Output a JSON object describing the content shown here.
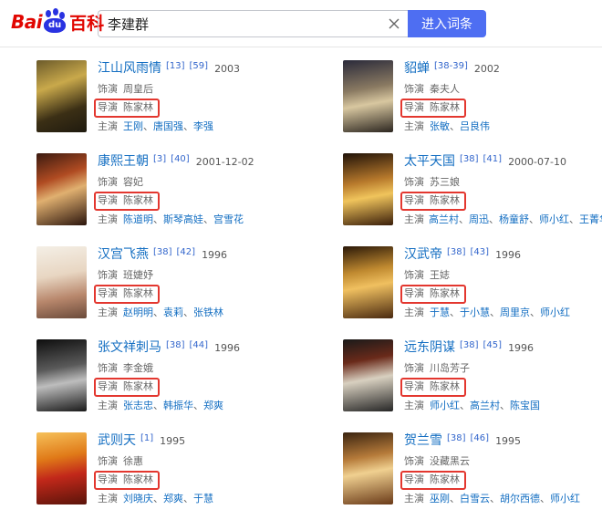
{
  "brand": {
    "bai": "Bai",
    "du": "du",
    "baike": "百科",
    "red": "#e10601",
    "blue": "#2932e1"
  },
  "search": {
    "value": "李建群",
    "button": "进入词条",
    "clear_icon": "close-icon"
  },
  "accent": {
    "link": "#136ec2",
    "highlight": "#e3372f",
    "button": "#4e6ef2"
  },
  "labels": {
    "role": "饰演",
    "director": "导演",
    "cast": "主演"
  },
  "works": [
    {
      "title": "江山风雨情",
      "refs": [
        "[13]",
        "[59]"
      ],
      "year": "2003",
      "role": "周皇后",
      "director": "陈家林",
      "cast": [
        "王刚",
        "唐国强",
        "李强"
      ]
    },
    {
      "title": "貂蝉",
      "refs": [
        "[38-39]"
      ],
      "year": "2002",
      "role": "秦夫人",
      "director": "陈家林",
      "cast": [
        "张敏",
        "吕良伟"
      ]
    },
    {
      "title": "康熙王朝",
      "refs": [
        "[3]",
        "[40]"
      ],
      "year": "2001-12-02",
      "role": "容妃",
      "director": "陈家林",
      "cast": [
        "陈道明",
        "斯琴高娃",
        "宫雪花"
      ]
    },
    {
      "title": "太平天国",
      "refs": [
        "[38]",
        "[41]"
      ],
      "year": "2000-07-10",
      "role": "苏三娘",
      "director": "陈家林",
      "cast": [
        "高兰村",
        "周迅",
        "杨童舒",
        "师小红",
        "王菁华"
      ]
    },
    {
      "title": "汉宫飞燕",
      "refs": [
        "[38]",
        "[42]"
      ],
      "year": "1996",
      "role": "班婕妤",
      "director": "陈家林",
      "cast": [
        "赵明明",
        "袁莉",
        "张铁林"
      ]
    },
    {
      "title": "汉武帝",
      "refs": [
        "[38]",
        "[43]"
      ],
      "year": "1996",
      "role": "王娡",
      "director": "陈家林",
      "cast": [
        "于慧",
        "于小慧",
        "周里京",
        "师小红"
      ]
    },
    {
      "title": "张文祥刺马",
      "refs": [
        "[38]",
        "[44]"
      ],
      "year": "1996",
      "role": "李金娥",
      "director": "陈家林",
      "cast": [
        "张志忠",
        "韩振华",
        "郑爽"
      ]
    },
    {
      "title": "远东阴谋",
      "refs": [
        "[38]",
        "[45]"
      ],
      "year": "1996",
      "role": "川岛芳子",
      "director": "陈家林",
      "cast": [
        "师小红",
        "高兰村",
        "陈宝国"
      ]
    },
    {
      "title": "武则天",
      "refs": [
        "[1]"
      ],
      "year": "1995",
      "role": "徐惠",
      "director": "陈家林",
      "cast": [
        "刘晓庆",
        "郑爽",
        "于慧"
      ]
    },
    {
      "title": "贺兰雪",
      "refs": [
        "[38]",
        "[46]"
      ],
      "year": "1995",
      "role": "没藏黑云",
      "director": "陈家林",
      "cast": [
        "巫刚",
        "白雪云",
        "胡尔西德",
        "师小红"
      ]
    }
  ]
}
